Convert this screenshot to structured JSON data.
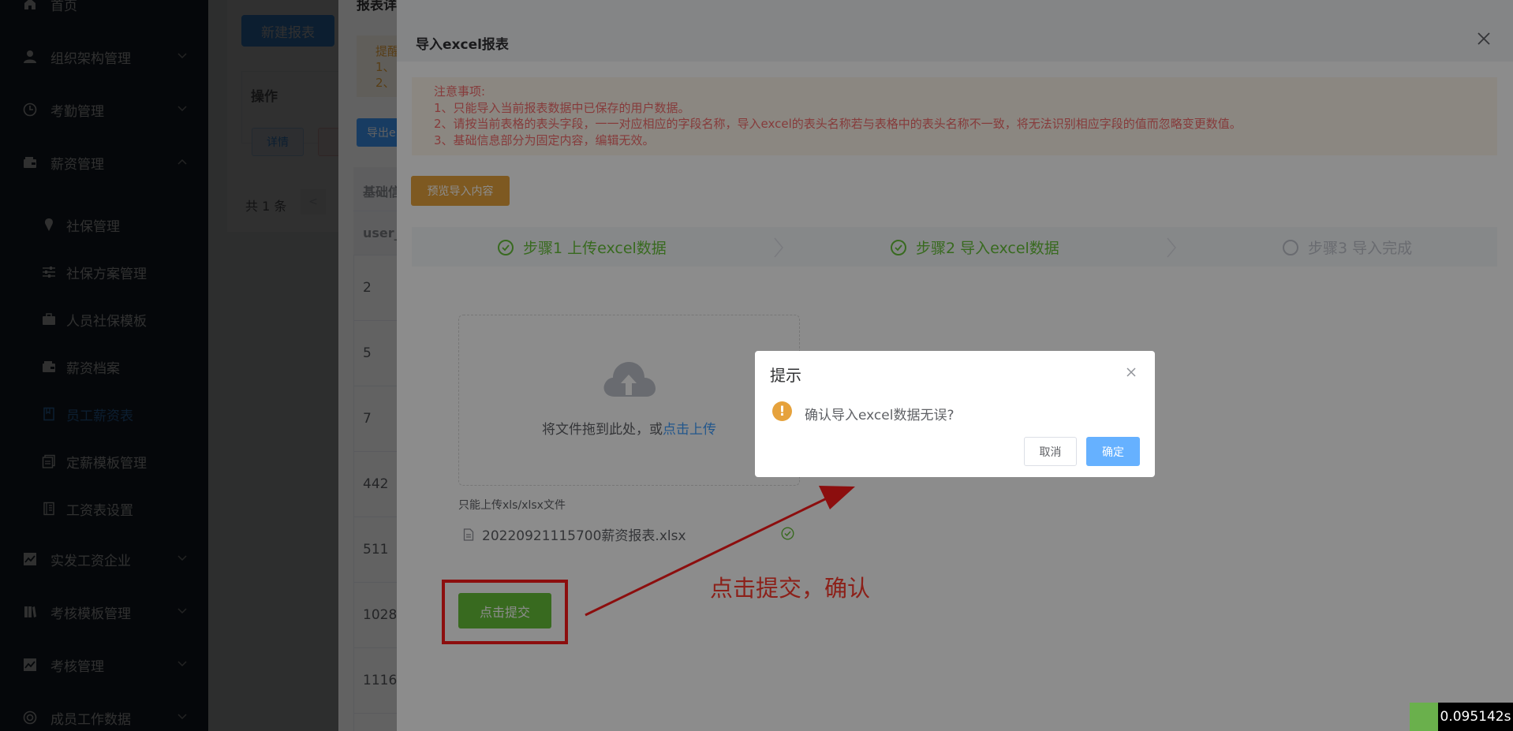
{
  "sidebar": {
    "items": [
      {
        "label": "首页",
        "icon": "home-icon",
        "type": "top"
      },
      {
        "label": "组织架构管理",
        "icon": "user-icon",
        "type": "top",
        "arrow": "down"
      },
      {
        "label": "考勤管理",
        "icon": "clock-icon",
        "type": "top",
        "arrow": "down"
      },
      {
        "label": "薪资管理",
        "icon": "wallet-icon",
        "type": "top",
        "arrow": "up"
      },
      {
        "label": "社保管理",
        "icon": "pin-icon",
        "type": "sub"
      },
      {
        "label": "社保方案管理",
        "icon": "sliders-icon",
        "type": "sub"
      },
      {
        "label": "人员社保模板",
        "icon": "briefcase-icon",
        "type": "sub"
      },
      {
        "label": "薪资档案",
        "icon": "wallet-icon",
        "type": "sub"
      },
      {
        "label": "员工薪资表",
        "icon": "bookmark-icon",
        "type": "sub",
        "active": true
      },
      {
        "label": "定薪模板管理",
        "icon": "copy-icon",
        "type": "sub"
      },
      {
        "label": "工资表设置",
        "icon": "notebook-icon",
        "type": "sub"
      },
      {
        "label": "实发工资企业",
        "icon": "chart-icon",
        "type": "top",
        "arrow": "down"
      },
      {
        "label": "考核模板管理",
        "icon": "books-icon",
        "type": "top",
        "arrow": "down"
      },
      {
        "label": "考核管理",
        "icon": "chart-icon",
        "type": "top",
        "arrow": "down"
      },
      {
        "label": "成员工作数据",
        "icon": "lifebuoy-icon",
        "type": "top",
        "arrow": "down"
      }
    ]
  },
  "background_page": {
    "new_report_button": "新建报表",
    "ops_header": "操作",
    "detail_button": "详情",
    "pager_total": "共 1 条",
    "pager_prev": "<"
  },
  "report_dialog": {
    "title": "报表详情",
    "tip_prefix": "提醒",
    "tip_lines": [
      "1、",
      "2、"
    ],
    "export_button": "导出e",
    "table_header_1": "基础信",
    "table_header_2": "user_",
    "rows": [
      "2",
      "5",
      "7",
      "442",
      "511",
      "1028",
      "1116"
    ]
  },
  "import_dialog": {
    "title": "导入excel报表",
    "notice_lines": [
      "注意事项:",
      "1、只能导入当前报表数据中已保存的用户数据。",
      "2、请按当前表格的表头字段，一一对应相应的字段名称，导入excel的表头名称若与表格中的表头名称不一致，将无法识别相应字段的值而忽略变更数值。",
      "3、基础信息部分为固定内容，编辑无效。"
    ],
    "preview_button": "预览导入内容",
    "steps": [
      {
        "label": "步骤1 上传excel数据",
        "status": "done"
      },
      {
        "label": "步骤2 导入excel数据",
        "status": "done"
      },
      {
        "label": "步骤3 导入完成",
        "status": "wait"
      }
    ],
    "upload_text": "将文件拖到此处，或",
    "upload_link": "点击上传",
    "upload_hint": "只能上传xls/xlsx文件",
    "file_name": "20220921115700薪资报表.xlsx",
    "submit_button": "点击提交"
  },
  "annotation": {
    "text": "点击提交，确认",
    "color": "#ff3b2f"
  },
  "message_box": {
    "title": "提示",
    "message": "确认导入excel数据无误?",
    "cancel_button": "取消",
    "confirm_button": "确定",
    "warn_glyph": "!"
  },
  "timer": {
    "value": "0.095142s"
  },
  "colors": {
    "sidebar_bg": "#1f2a38",
    "primary": "#409eff",
    "success": "#67c23a",
    "warning": "#e6a23c",
    "danger": "#f56c6c"
  }
}
